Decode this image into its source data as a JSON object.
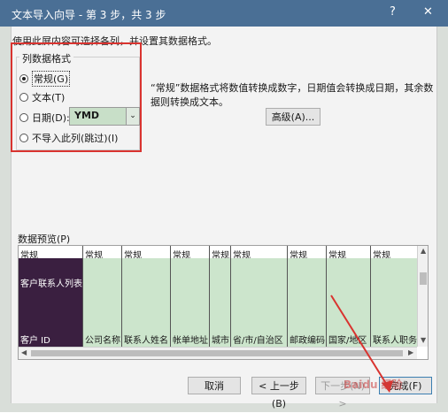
{
  "window": {
    "title": "文本导入向导 - 第 3 步，共 3 步",
    "help": "?",
    "close": "✕"
  },
  "intro": "使用此屏内容可选择各列，并设置其数据格式。",
  "format_group": {
    "legend": "列数据格式",
    "options": [
      "常规(G)",
      "文本(T)",
      "日期(D):",
      "不导入此列(跳过)(I)"
    ],
    "selected": "常规(G)",
    "date_value": "YMD"
  },
  "description": "“常规”数据格式将数值转换成数字，日期值会转换成日期，其余数据则转换成文本。",
  "advanced_button": "高级(A)...",
  "preview": {
    "label": "数据预览(P)",
    "columns": [
      {
        "header": "常规",
        "top": "客户联系人列表",
        "bottom": "客户 ID"
      },
      {
        "header": "常规",
        "top": "",
        "bottom": "公司名称"
      },
      {
        "header": "常规",
        "top": "",
        "bottom": "联系人姓名"
      },
      {
        "header": "常规",
        "top": "",
        "bottom": "帐单地址"
      },
      {
        "header": "常规",
        "top": "",
        "bottom": "城市"
      },
      {
        "header": "常规",
        "top": "",
        "bottom": "省/市/自治区"
      },
      {
        "header": "常规",
        "top": "",
        "bottom": "邮政编码"
      },
      {
        "header": "常规",
        "top": "",
        "bottom": "国家/地区"
      },
      {
        "header": "常规",
        "top": "",
        "bottom": "联系人职务"
      }
    ]
  },
  "buttons": {
    "cancel": "取消",
    "back": "< 上一步(B)",
    "next": "下一步(N) >",
    "finish": "完成(F)"
  },
  "watermark": "Baidu 经验",
  "colors": {
    "highlight": "#d9332f",
    "titlebar": "#4a6f95",
    "preview_green": "#cce5cc"
  }
}
